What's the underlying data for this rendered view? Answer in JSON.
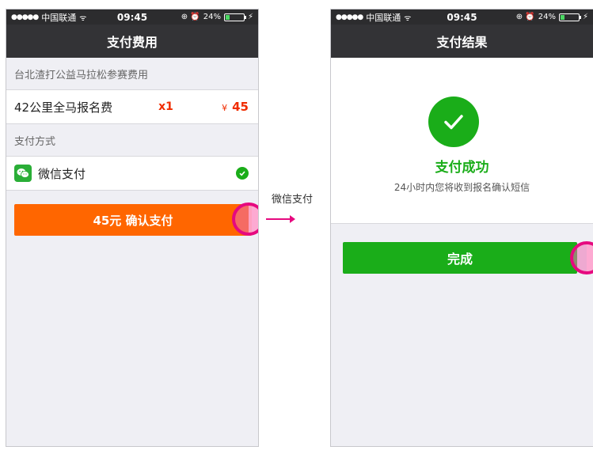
{
  "status_bar": {
    "signal": "●●●●●",
    "carrier": "中国联通",
    "wifi": "ᯤ",
    "time": "09:45",
    "icons": "⊕ ⏰",
    "battery_text": "24%",
    "charge_icon": "⚡",
    "battery_level": 0.24
  },
  "left_screen": {
    "title": "支付费用",
    "event_name": "台北渣打公益马拉松参赛费用",
    "item": {
      "name": "42公里全马报名费",
      "quantity": "x1",
      "currency": "¥",
      "price": "45"
    },
    "payment_section_label": "支付方式",
    "payment_method": "微信支付",
    "confirm_button": "45元 确认支付"
  },
  "flow": {
    "label": "微信支付"
  },
  "right_screen": {
    "title": "支付结果",
    "success_title": "支付成功",
    "success_subtitle": "24小时内您将收到报名确认短信",
    "done_button": "完成"
  },
  "colors": {
    "accent_orange": "#ff6600",
    "wechat_green": "#1aad19",
    "price_red": "#f02c00",
    "tap_marker": "#e6097f",
    "navbar": "#333336"
  },
  "icons": {
    "wechat": "wechat-icon",
    "check": "check-icon",
    "arrow": "arrow-right-icon"
  }
}
